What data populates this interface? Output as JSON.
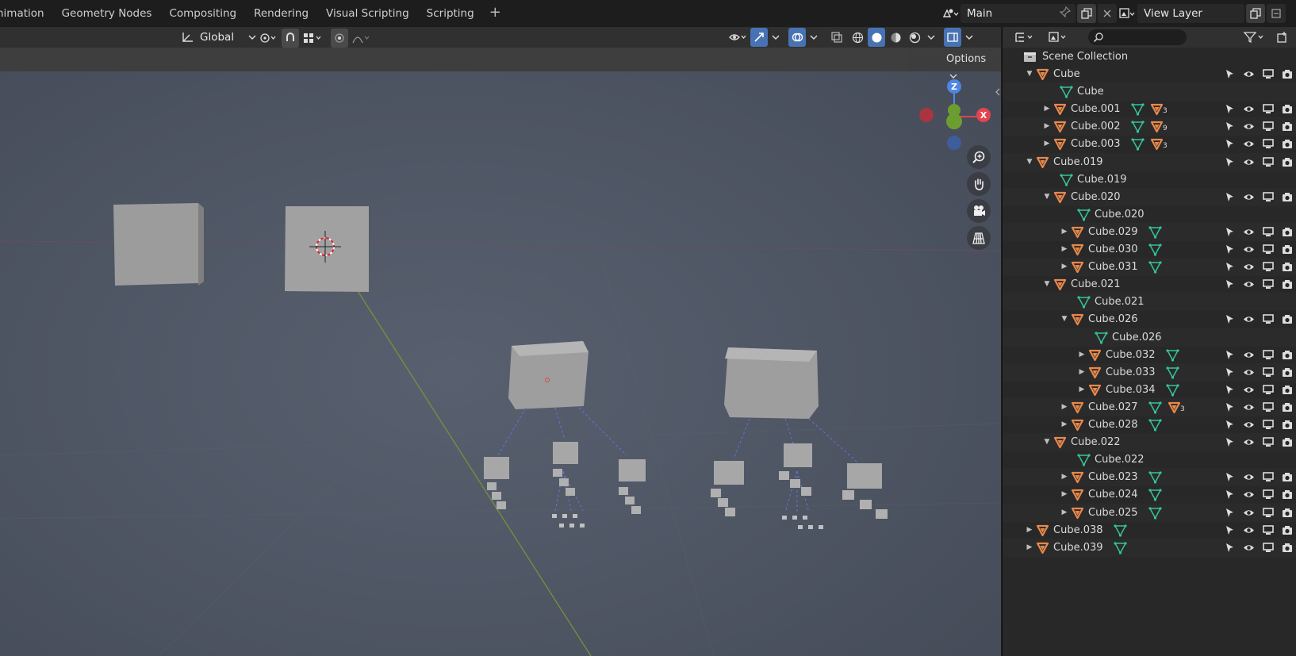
{
  "workspace_tabs": [
    "nimation",
    "Geometry Nodes",
    "Compositing",
    "Rendering",
    "Visual Scripting",
    "Scripting"
  ],
  "add_workspace": "+",
  "scene": {
    "name": "Main"
  },
  "view_layer": {
    "name": "View Layer"
  },
  "viewport": {
    "orientation": "Global",
    "options_label": "Options"
  },
  "gizmo": {
    "z": "Z",
    "x": "X"
  },
  "outliner": {
    "root": "Scene Collection",
    "rows": [
      {
        "label": "Cube",
        "depth": 0,
        "type": "object",
        "expand": "open",
        "extra": ""
      },
      {
        "label": "Cube",
        "depth": 1,
        "type": "mesh",
        "expand": "none",
        "extra": ""
      },
      {
        "label": "Cube.001",
        "depth": 1,
        "type": "object",
        "expand": "closed",
        "extra": "mesh+obj",
        "count": "3"
      },
      {
        "label": "Cube.002",
        "depth": 1,
        "type": "object",
        "expand": "closed",
        "extra": "mesh+obj",
        "count": "9"
      },
      {
        "label": "Cube.003",
        "depth": 1,
        "type": "object",
        "expand": "closed",
        "extra": "mesh+obj",
        "count": "3"
      },
      {
        "label": "Cube.019",
        "depth": 0,
        "type": "object",
        "expand": "open",
        "extra": ""
      },
      {
        "label": "Cube.019",
        "depth": 1,
        "type": "mesh",
        "expand": "none",
        "extra": ""
      },
      {
        "label": "Cube.020",
        "depth": 1,
        "type": "object",
        "expand": "open",
        "extra": ""
      },
      {
        "label": "Cube.020",
        "depth": 2,
        "type": "mesh",
        "expand": "none",
        "extra": ""
      },
      {
        "label": "Cube.029",
        "depth": 2,
        "type": "object",
        "expand": "closed",
        "extra": "mesh"
      },
      {
        "label": "Cube.030",
        "depth": 2,
        "type": "object",
        "expand": "closed",
        "extra": "mesh"
      },
      {
        "label": "Cube.031",
        "depth": 2,
        "type": "object",
        "expand": "closed",
        "extra": "mesh"
      },
      {
        "label": "Cube.021",
        "depth": 1,
        "type": "object",
        "expand": "open",
        "extra": ""
      },
      {
        "label": "Cube.021",
        "depth": 2,
        "type": "mesh",
        "expand": "none",
        "extra": ""
      },
      {
        "label": "Cube.026",
        "depth": 2,
        "type": "object",
        "expand": "open",
        "extra": ""
      },
      {
        "label": "Cube.026",
        "depth": 3,
        "type": "mesh",
        "expand": "none",
        "extra": ""
      },
      {
        "label": "Cube.032",
        "depth": 3,
        "type": "object",
        "expand": "closed",
        "extra": "mesh"
      },
      {
        "label": "Cube.033",
        "depth": 3,
        "type": "object",
        "expand": "closed",
        "extra": "mesh"
      },
      {
        "label": "Cube.034",
        "depth": 3,
        "type": "object",
        "expand": "closed",
        "extra": "mesh"
      },
      {
        "label": "Cube.027",
        "depth": 2,
        "type": "object",
        "expand": "closed",
        "extra": "mesh+obj",
        "count": "3"
      },
      {
        "label": "Cube.028",
        "depth": 2,
        "type": "object",
        "expand": "closed",
        "extra": "mesh"
      },
      {
        "label": "Cube.022",
        "depth": 1,
        "type": "object",
        "expand": "open",
        "extra": ""
      },
      {
        "label": "Cube.022",
        "depth": 2,
        "type": "mesh",
        "expand": "none",
        "extra": ""
      },
      {
        "label": "Cube.023",
        "depth": 2,
        "type": "object",
        "expand": "closed",
        "extra": "mesh"
      },
      {
        "label": "Cube.024",
        "depth": 2,
        "type": "object",
        "expand": "closed",
        "extra": "mesh"
      },
      {
        "label": "Cube.025",
        "depth": 2,
        "type": "object",
        "expand": "closed",
        "extra": "mesh"
      },
      {
        "label": "Cube.038",
        "depth": 0,
        "type": "object",
        "expand": "closed",
        "extra": "mesh"
      },
      {
        "label": "Cube.039",
        "depth": 0,
        "type": "object",
        "expand": "closed",
        "extra": "mesh"
      }
    ]
  },
  "colors": {
    "object": "#e8884a",
    "mesh": "#35c39a",
    "accent": "#4772b3"
  }
}
